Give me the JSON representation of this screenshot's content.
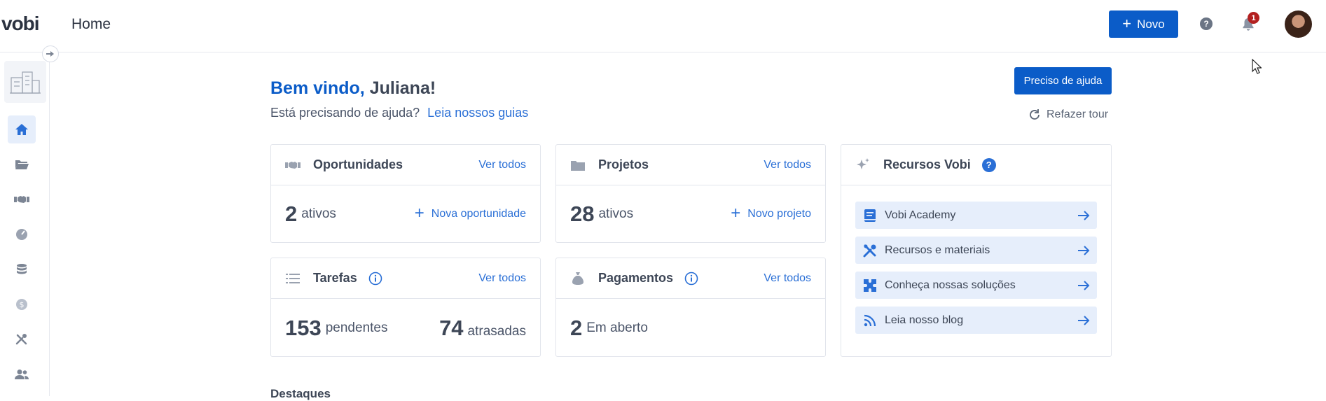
{
  "header": {
    "logo": "vobi",
    "page_title": "Home",
    "new_button_label": "Novo",
    "help_glyph": "?",
    "notification_count": "1"
  },
  "sidebar": {
    "items": [
      {
        "icon": "home-icon",
        "active": true
      },
      {
        "icon": "folder-icon"
      },
      {
        "icon": "handshake-icon"
      },
      {
        "icon": "gauge-icon"
      },
      {
        "icon": "database-icon"
      },
      {
        "icon": "dollar-icon"
      },
      {
        "icon": "tools-icon"
      },
      {
        "icon": "users-icon"
      }
    ]
  },
  "main": {
    "greeting_prefix": "Bem vindo,",
    "greeting_name": "Juliana!",
    "help_question": "Está precisando de ajuda?",
    "guides_link": "Leia nossos guias",
    "help_button": "Preciso de ajuda",
    "redo_tour": "Refazer tour",
    "cards": {
      "oportunidades": {
        "title": "Oportunidades",
        "see_all": "Ver todos",
        "count": "2",
        "unit": "ativos",
        "action": "Nova oportunidade"
      },
      "projetos": {
        "title": "Projetos",
        "see_all": "Ver todos",
        "count": "28",
        "unit": "ativos",
        "action": "Novo projeto"
      },
      "tarefas": {
        "title": "Tarefas",
        "see_all": "Ver todos",
        "pending_count": "153",
        "pending_unit": "pendentes",
        "late_count": "74",
        "late_unit": "atrasadas"
      },
      "pagamentos": {
        "title": "Pagamentos",
        "see_all": "Ver todos",
        "count": "2",
        "unit": "Em aberto"
      },
      "recursos": {
        "title": "Recursos Vobi",
        "help_glyph": "?",
        "items": [
          {
            "label": "Vobi Academy",
            "icon": "book-icon"
          },
          {
            "label": "Recursos e materiais",
            "icon": "tools-icon"
          },
          {
            "label": "Conheça nossas soluções",
            "icon": "puzzle-icon"
          },
          {
            "label": "Leia nosso blog",
            "icon": "rss-icon"
          }
        ]
      }
    },
    "highlights_heading": "Destaques"
  },
  "colors": {
    "primary": "#0b5cc8",
    "link": "#2a6fd6",
    "text": "#3d4656",
    "resource_bg": "#e6eefb",
    "badge": "#b32020"
  }
}
